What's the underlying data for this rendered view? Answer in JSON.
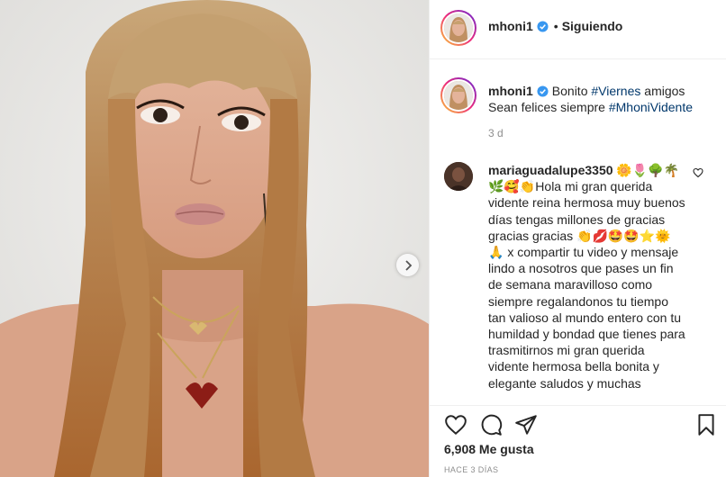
{
  "post": {
    "username": "mhoni1",
    "follow_status": "Siguiendo",
    "caption_prefix": "Bonito ",
    "caption_tag1": "#Viernes",
    "caption_mid": " amigos Sean felices siempre ",
    "caption_tag2": "#MhoniVidente",
    "time_ago": "3 d",
    "likes": "6,908 Me gusta",
    "date": "HACE 3 DÍAS"
  },
  "comment": {
    "username": "mariaguadalupe3350",
    "text": "🌼🌷🌳🌴🌿🥰👏Hola mi gran querida vidente reina hermosa muy buenos días tengas millones de gracias gracias gracias 👏💋🤩🤩⭐🌞🙏 x compartir tu video y mensaje lindo a nosotros que pases un fin de semana maravilloso como siempre regalandonos tu tiempo tan valioso al mundo entero con tu humildad y bondad que tienes para trasmitirnos mi gran querida vidente hermosa bella bonita y elegante saludos y muchas"
  },
  "icons": {
    "verified": "verified-badge-icon",
    "like": "heart-icon",
    "comment": "comment-icon",
    "share": "paper-plane-icon",
    "save": "bookmark-icon",
    "next": "chevron-right-icon"
  },
  "colors": {
    "text": "#262626",
    "muted": "#8e8e8e",
    "hashtag": "#00376b",
    "verified": "#3897f0",
    "border": "#efefef"
  }
}
